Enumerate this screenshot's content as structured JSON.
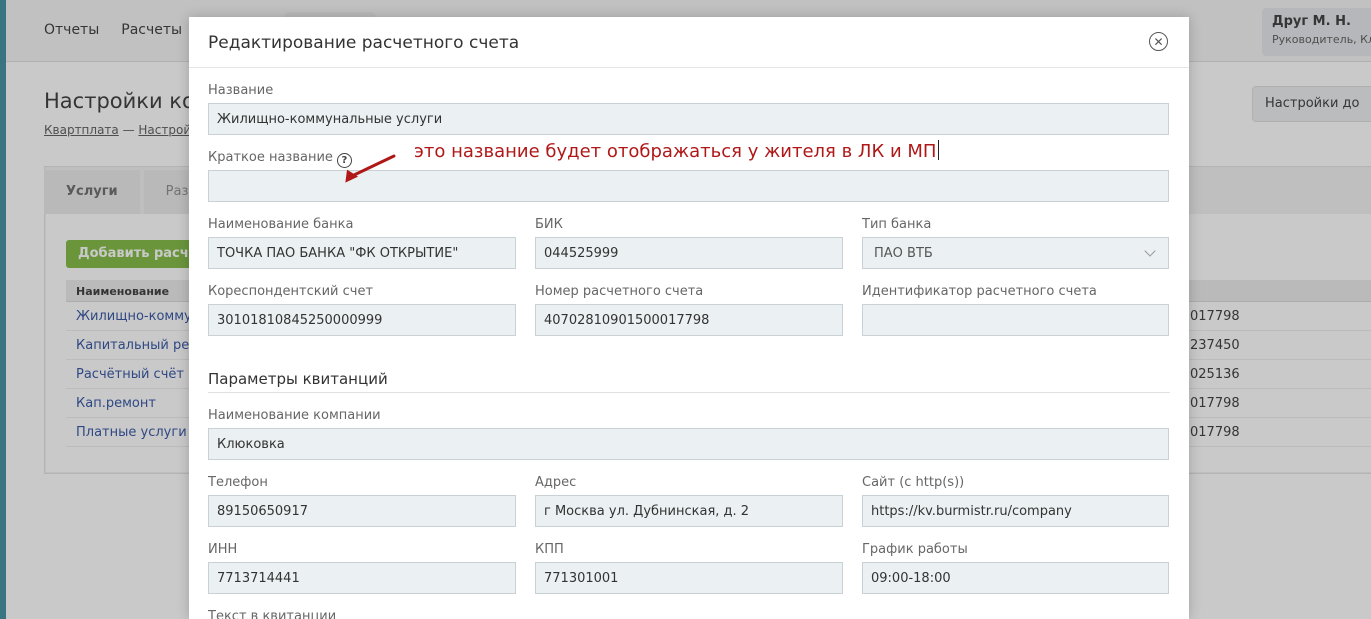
{
  "background": {
    "nav": [
      "Отчеты",
      "Расчеты"
    ],
    "user": {
      "name": "Друг М. Н.",
      "role": "Руководитель, Кл"
    },
    "page_title": "Настройки ко",
    "breadcrumb": {
      "first": "Квартплата",
      "separator": " — ",
      "second": "Настрой"
    },
    "settings_button": "Настройки до",
    "tabs": [
      "Услуги",
      "Разо"
    ],
    "add_button": "Добавить расчет",
    "table": {
      "header": "Наименование",
      "rows": [
        "Жилищно-коммуна",
        "Капитальный ремо",
        "Расчётный счёт по",
        "Кап.ремонт",
        "Платные услуги"
      ],
      "right_values": [
        "017798",
        "237450",
        "025136",
        "017798",
        "017798"
      ]
    }
  },
  "modal": {
    "title": "Редактирование расчетного счета",
    "close_icon": "close-circle-icon",
    "fields": {
      "name": {
        "label": "Название",
        "value": "Жилищно-коммунальные услуги"
      },
      "short_name": {
        "label": "Краткое название",
        "value": ""
      },
      "bank_name": {
        "label": "Наименование банка",
        "value": "ТОЧКА ПАО БАНКА \"ФК ОТКРЫТИЕ\""
      },
      "bik": {
        "label": "БИК",
        "value": "044525999"
      },
      "bank_type": {
        "label": "Тип банка",
        "value": "ПАО ВТБ"
      },
      "corr_account": {
        "label": "Кореспондентский счет",
        "value": "30101810845250000999"
      },
      "account_number": {
        "label": "Номер расчетного счета",
        "value": "40702810901500017798"
      },
      "account_id": {
        "label": "Идентификатор расчетного счета",
        "value": ""
      }
    },
    "receipt_section": {
      "title": "Параметры квитанций",
      "company_name": {
        "label": "Наименование компании",
        "value": "Клюковка"
      },
      "phone": {
        "label": "Телефон",
        "value": "89150650917"
      },
      "address": {
        "label": "Адрес",
        "value": "г Москва ул. Дубнинская, д. 2"
      },
      "site": {
        "label": "Сайт (с http(s))",
        "value": "https://kv.burmistr.ru/company"
      },
      "inn": {
        "label": "ИНН",
        "value": "7713714441"
      },
      "kpp": {
        "label": "КПП",
        "value": "771301001"
      },
      "schedule": {
        "label": "График работы",
        "value": "09:00-18:00"
      },
      "receipt_text": {
        "label": "Текст в квитанции"
      }
    }
  },
  "annotation": {
    "text": "это название будет отображаться у жителя в ЛК и МП",
    "color": "#b01818"
  }
}
